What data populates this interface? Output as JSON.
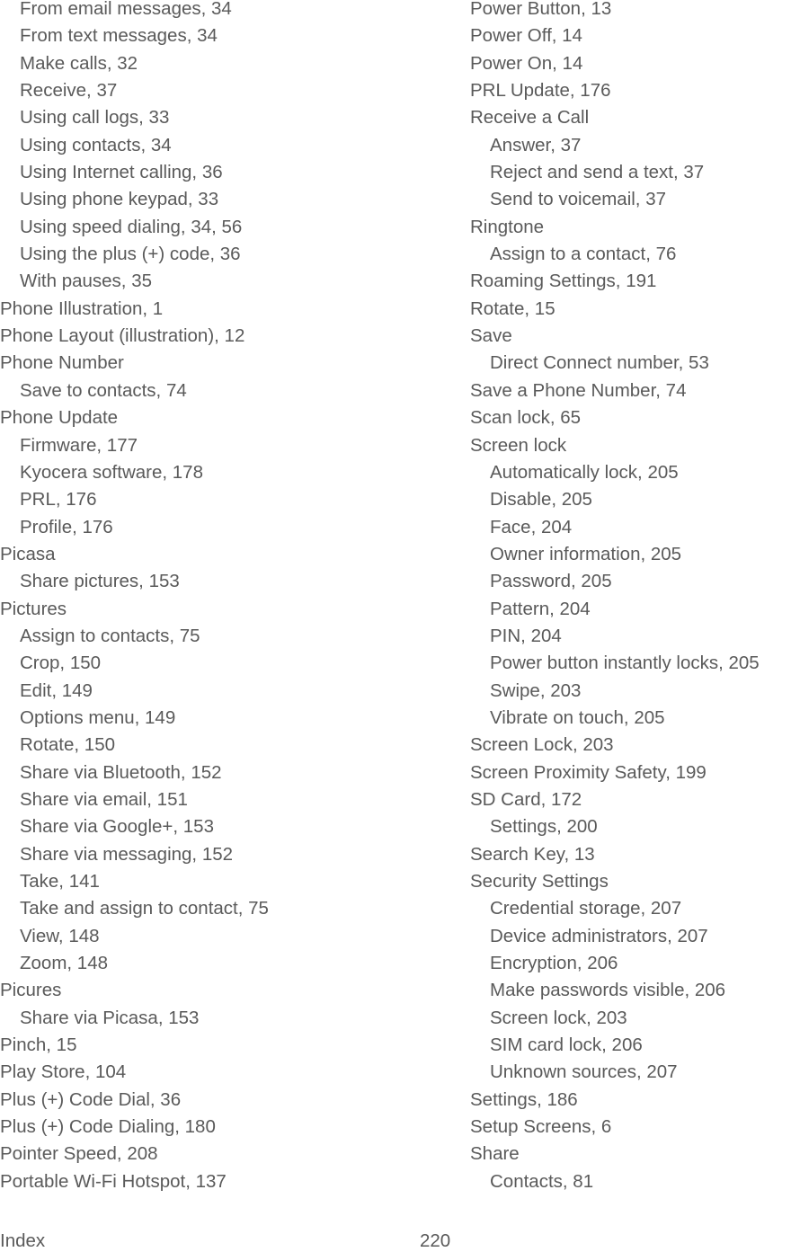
{
  "index": {
    "left_column": [
      {
        "text": "From email messages, 34",
        "level": 2
      },
      {
        "text": "From text messages, 34",
        "level": 2
      },
      {
        "text": "Make calls, 32",
        "level": 2
      },
      {
        "text": "Receive, 37",
        "level": 2
      },
      {
        "text": "Using call logs, 33",
        "level": 2
      },
      {
        "text": "Using contacts, 34",
        "level": 2
      },
      {
        "text": "Using Internet calling, 36",
        "level": 2
      },
      {
        "text": "Using phone keypad, 33",
        "level": 2
      },
      {
        "text": "Using speed dialing, 34, 56",
        "level": 2
      },
      {
        "text": "Using the plus (+) code, 36",
        "level": 2
      },
      {
        "text": "With pauses, 35",
        "level": 2
      },
      {
        "text": "Phone Illustration, 1",
        "level": 1
      },
      {
        "text": "Phone Layout (illustration), 12",
        "level": 1
      },
      {
        "text": "Phone Number",
        "level": 1
      },
      {
        "text": "Save to contacts, 74",
        "level": 2
      },
      {
        "text": "Phone Update",
        "level": 1
      },
      {
        "text": "Firmware, 177",
        "level": 2
      },
      {
        "text": "Kyocera software, 178",
        "level": 2
      },
      {
        "text": "PRL, 176",
        "level": 2
      },
      {
        "text": "Profile, 176",
        "level": 2
      },
      {
        "text": "Picasa",
        "level": 1
      },
      {
        "text": "Share pictures, 153",
        "level": 2
      },
      {
        "text": "Pictures",
        "level": 1
      },
      {
        "text": "Assign to contacts, 75",
        "level": 2
      },
      {
        "text": "Crop, 150",
        "level": 2
      },
      {
        "text": "Edit, 149",
        "level": 2
      },
      {
        "text": "Options menu, 149",
        "level": 2
      },
      {
        "text": "Rotate, 150",
        "level": 2
      },
      {
        "text": "Share via Bluetooth, 152",
        "level": 2
      },
      {
        "text": "Share via email, 151",
        "level": 2
      },
      {
        "text": "Share via Google+, 153",
        "level": 2
      },
      {
        "text": "Share via messaging, 152",
        "level": 2
      },
      {
        "text": "Take, 141",
        "level": 2
      },
      {
        "text": "Take and assign to contact, 75",
        "level": 2
      },
      {
        "text": "View, 148",
        "level": 2
      },
      {
        "text": "Zoom, 148",
        "level": 2
      },
      {
        "text": "Picures",
        "level": 1
      },
      {
        "text": "Share via Picasa, 153",
        "level": 2
      },
      {
        "text": "Pinch, 15",
        "level": 1
      },
      {
        "text": "Play Store, 104",
        "level": 1
      },
      {
        "text": "Plus (+) Code Dial, 36",
        "level": 1
      },
      {
        "text": "Plus (+) Code Dialing, 180",
        "level": 1
      },
      {
        "text": "Pointer Speed, 208",
        "level": 1
      },
      {
        "text": "Portable Wi-Fi Hotspot, 137",
        "level": 1
      }
    ],
    "right_column": [
      {
        "text": "Power Button, 13",
        "level": 1
      },
      {
        "text": "Power Off, 14",
        "level": 1
      },
      {
        "text": "Power On, 14",
        "level": 1
      },
      {
        "text": "PRL Update, 176",
        "level": 1
      },
      {
        "text": "Receive a Call",
        "level": 1
      },
      {
        "text": "Answer, 37",
        "level": 2
      },
      {
        "text": "Reject and send a text, 37",
        "level": 2
      },
      {
        "text": "Send to voicemail, 37",
        "level": 2
      },
      {
        "text": "Ringtone",
        "level": 1
      },
      {
        "text": "Assign to a contact, 76",
        "level": 2
      },
      {
        "text": "Roaming Settings, 191",
        "level": 1
      },
      {
        "text": "Rotate, 15",
        "level": 1
      },
      {
        "text": "Save",
        "level": 1
      },
      {
        "text": "Direct Connect number, 53",
        "level": 2
      },
      {
        "text": "Save a Phone Number, 74",
        "level": 1
      },
      {
        "text": "Scan lock, 65",
        "level": 1
      },
      {
        "text": "Screen lock",
        "level": 1
      },
      {
        "text": "Automatically lock, 205",
        "level": 2
      },
      {
        "text": "Disable, 205",
        "level": 2
      },
      {
        "text": "Face, 204",
        "level": 2
      },
      {
        "text": "Owner information, 205",
        "level": 2
      },
      {
        "text": "Password, 205",
        "level": 2
      },
      {
        "text": "Pattern, 204",
        "level": 2
      },
      {
        "text": "PIN, 204",
        "level": 2
      },
      {
        "text": "Power button instantly locks, 205",
        "level": 2
      },
      {
        "text": "Swipe, 203",
        "level": 2
      },
      {
        "text": "Vibrate on touch, 205",
        "level": 2
      },
      {
        "text": "Screen Lock, 203",
        "level": 1
      },
      {
        "text": "Screen Proximity Safety, 199",
        "level": 1
      },
      {
        "text": "SD Card, 172",
        "level": 1
      },
      {
        "text": "Settings, 200",
        "level": 2
      },
      {
        "text": "Search Key, 13",
        "level": 1
      },
      {
        "text": "Security Settings",
        "level": 1
      },
      {
        "text": "Credential storage, 207",
        "level": 2
      },
      {
        "text": "Device administrators, 207",
        "level": 2
      },
      {
        "text": "Encryption, 206",
        "level": 2
      },
      {
        "text": "Make passwords visible, 206",
        "level": 2
      },
      {
        "text": "Screen lock, 203",
        "level": 2
      },
      {
        "text": "SIM card lock, 206",
        "level": 2
      },
      {
        "text": "Unknown sources, 207",
        "level": 2
      },
      {
        "text": "Settings, 186",
        "level": 1
      },
      {
        "text": "Setup Screens, 6",
        "level": 1
      },
      {
        "text": "Share",
        "level": 1
      },
      {
        "text": "Contacts, 81",
        "level": 2
      }
    ]
  },
  "footer": {
    "section": "Index",
    "page_number": "220"
  },
  "colors": {
    "text": "#5a5a5a",
    "background": "#ffffff"
  }
}
